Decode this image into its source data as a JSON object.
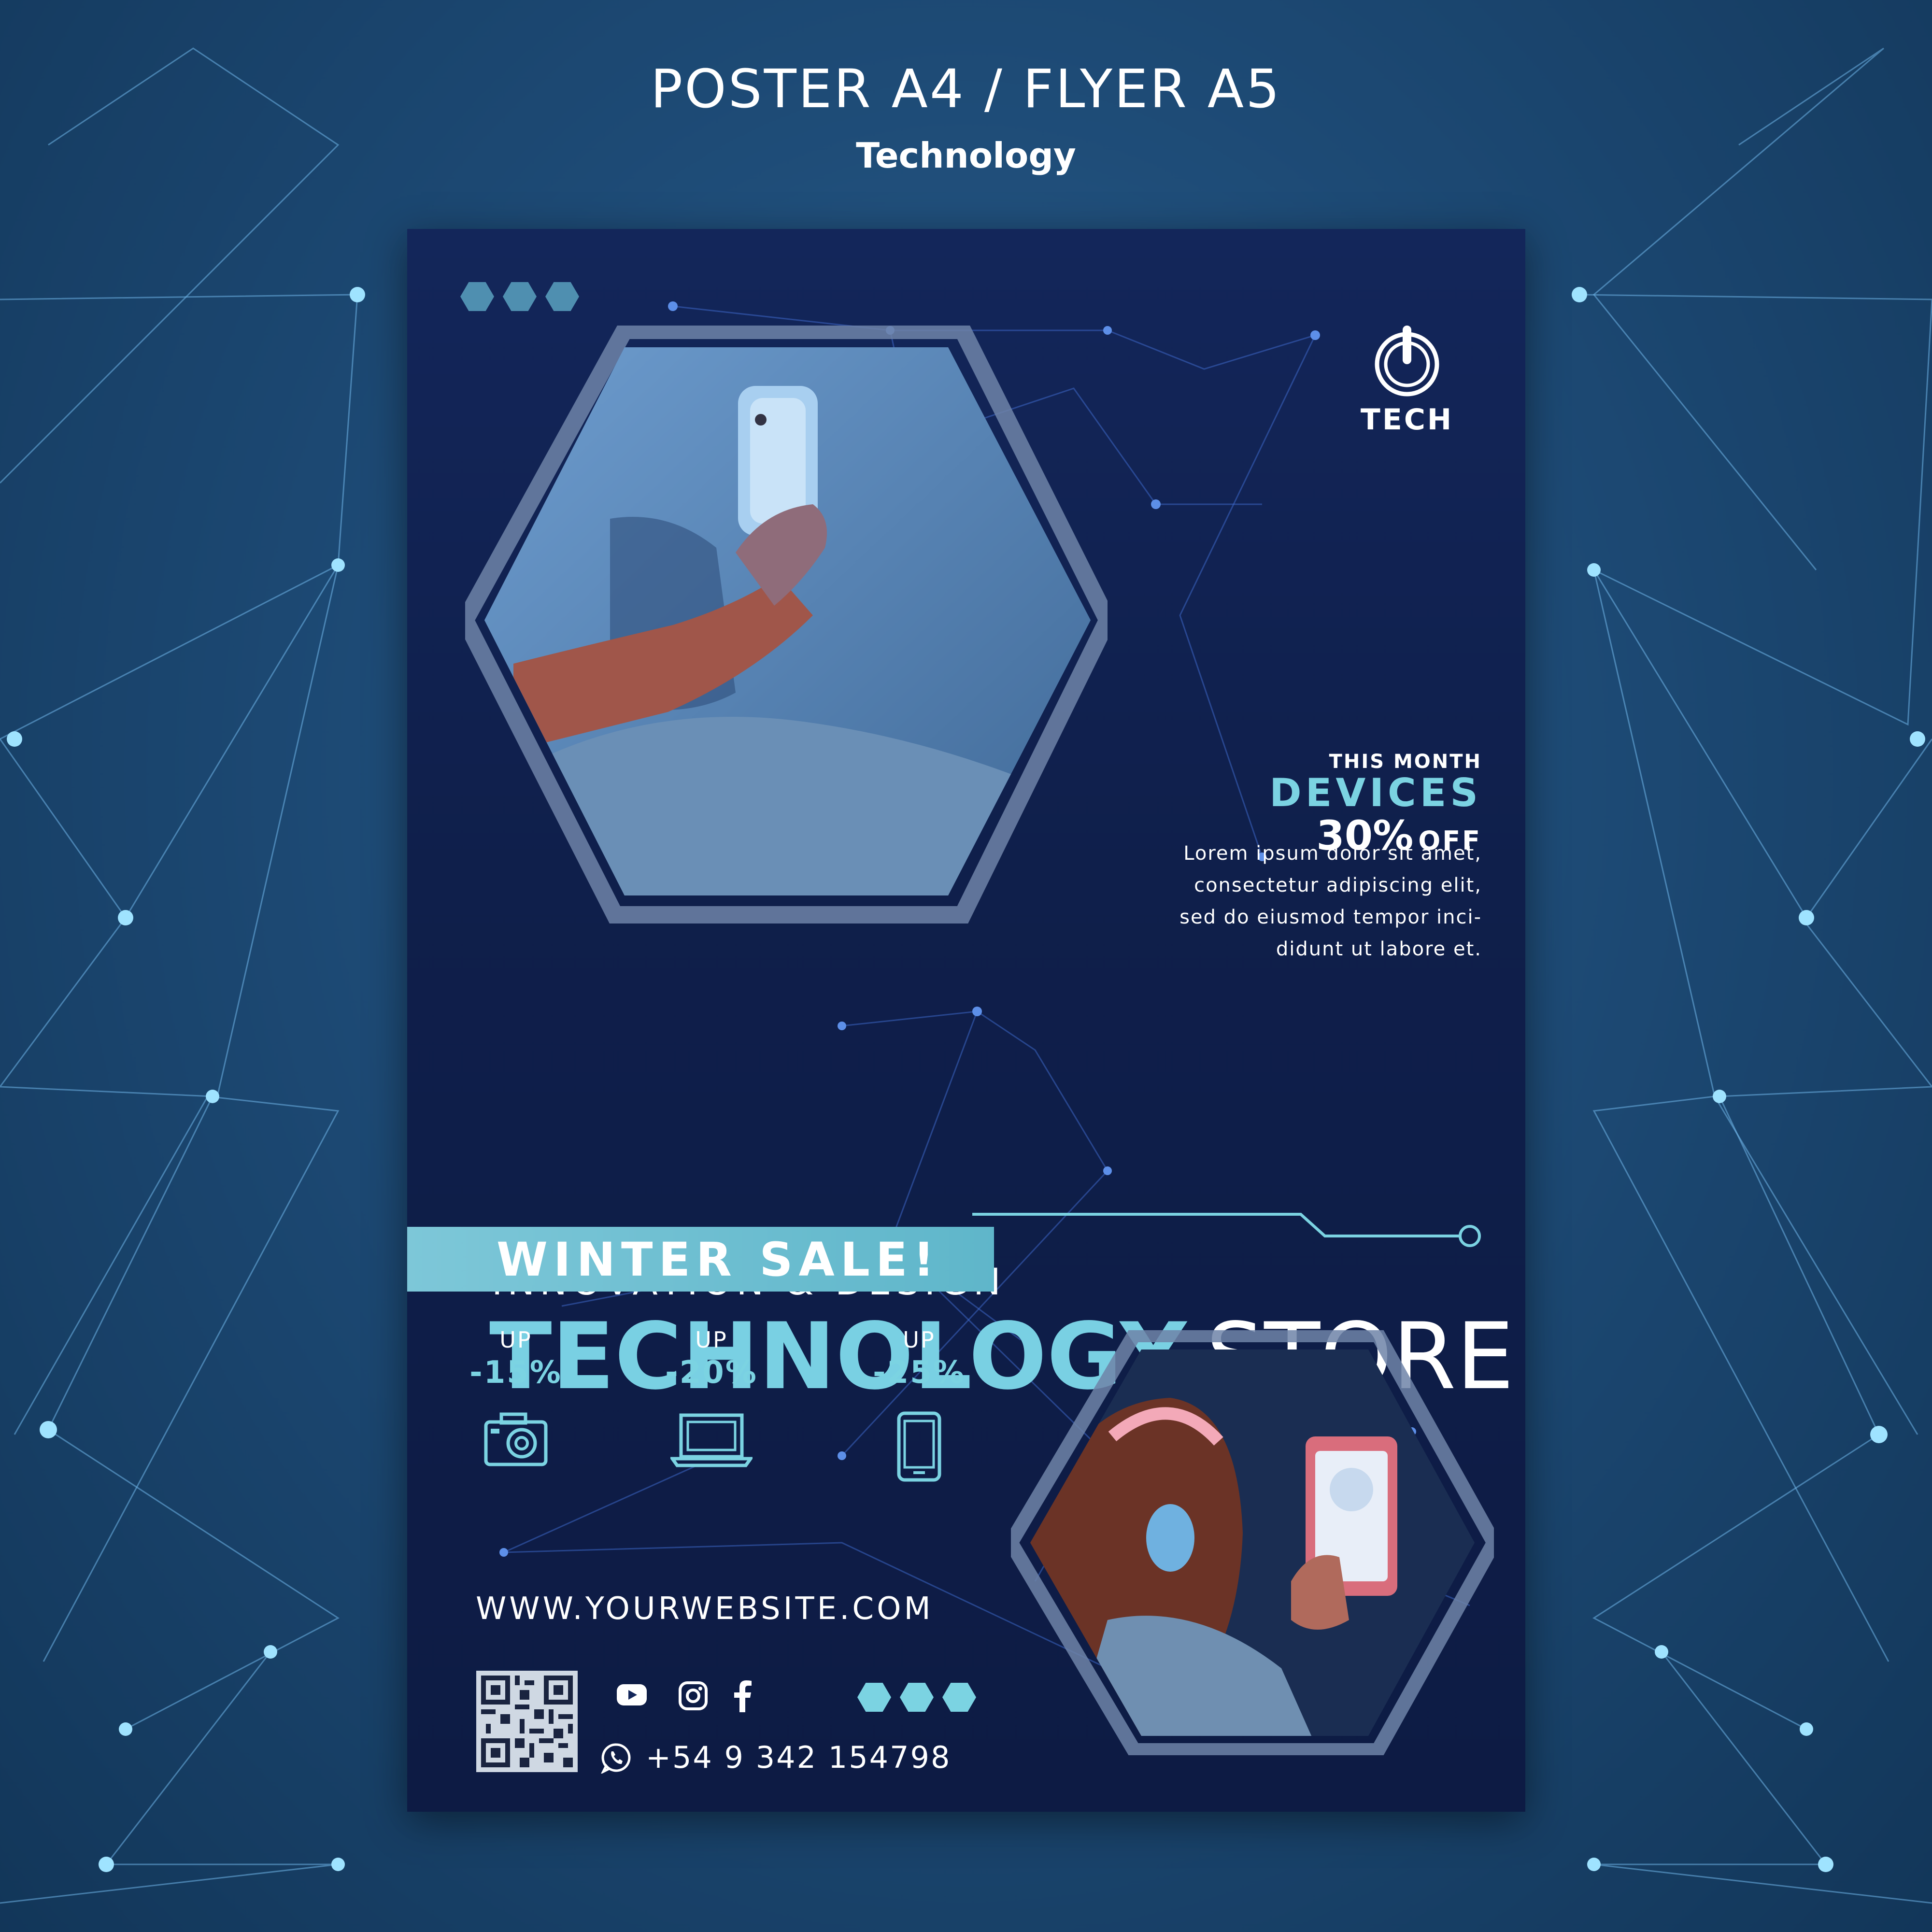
{
  "header": {
    "title": "POSTER A4 / FLYER A5",
    "subtitle": "Technology"
  },
  "poster": {
    "logo": {
      "icon": "power-icon",
      "label": "TECH"
    },
    "promo": {
      "kicker": "THIS MONTH",
      "headline": "DEVICES",
      "percent": "30%",
      "off": "OFF"
    },
    "lorem_lines": [
      "Lorem ipsum dolor sit amet,",
      "consectetur adipiscing elit,",
      "sed do eiusmod tempor inci-",
      "didunt ut labore et."
    ],
    "tagline": "INNOVATION & DESIGN",
    "title_accent": "TECHNOLOGY",
    "title_rest": "STORE",
    "banner": "WINTER SALE!",
    "discounts": [
      {
        "up": "UP",
        "value": "-15%",
        "icon": "camera-icon"
      },
      {
        "up": "UP",
        "value": "-20%",
        "icon": "laptop-icon"
      },
      {
        "up": "UP",
        "value": "-25%",
        "icon": "smartphone-icon"
      }
    ],
    "website": "WWW.YOURWEBSITE.COM",
    "social_icons": [
      "youtube-icon",
      "instagram-icon",
      "facebook-icon"
    ],
    "phone": "+54 9 342 154798",
    "photos": [
      "person-holding-smartphone-photo",
      "girl-with-headphones-and-tablet-photo"
    ]
  },
  "colors": {
    "accent": "#7bd3e2",
    "poster_bg": "#0f1f4b",
    "page_bg": "#1d4a75",
    "banner": "#6fbfd2"
  }
}
